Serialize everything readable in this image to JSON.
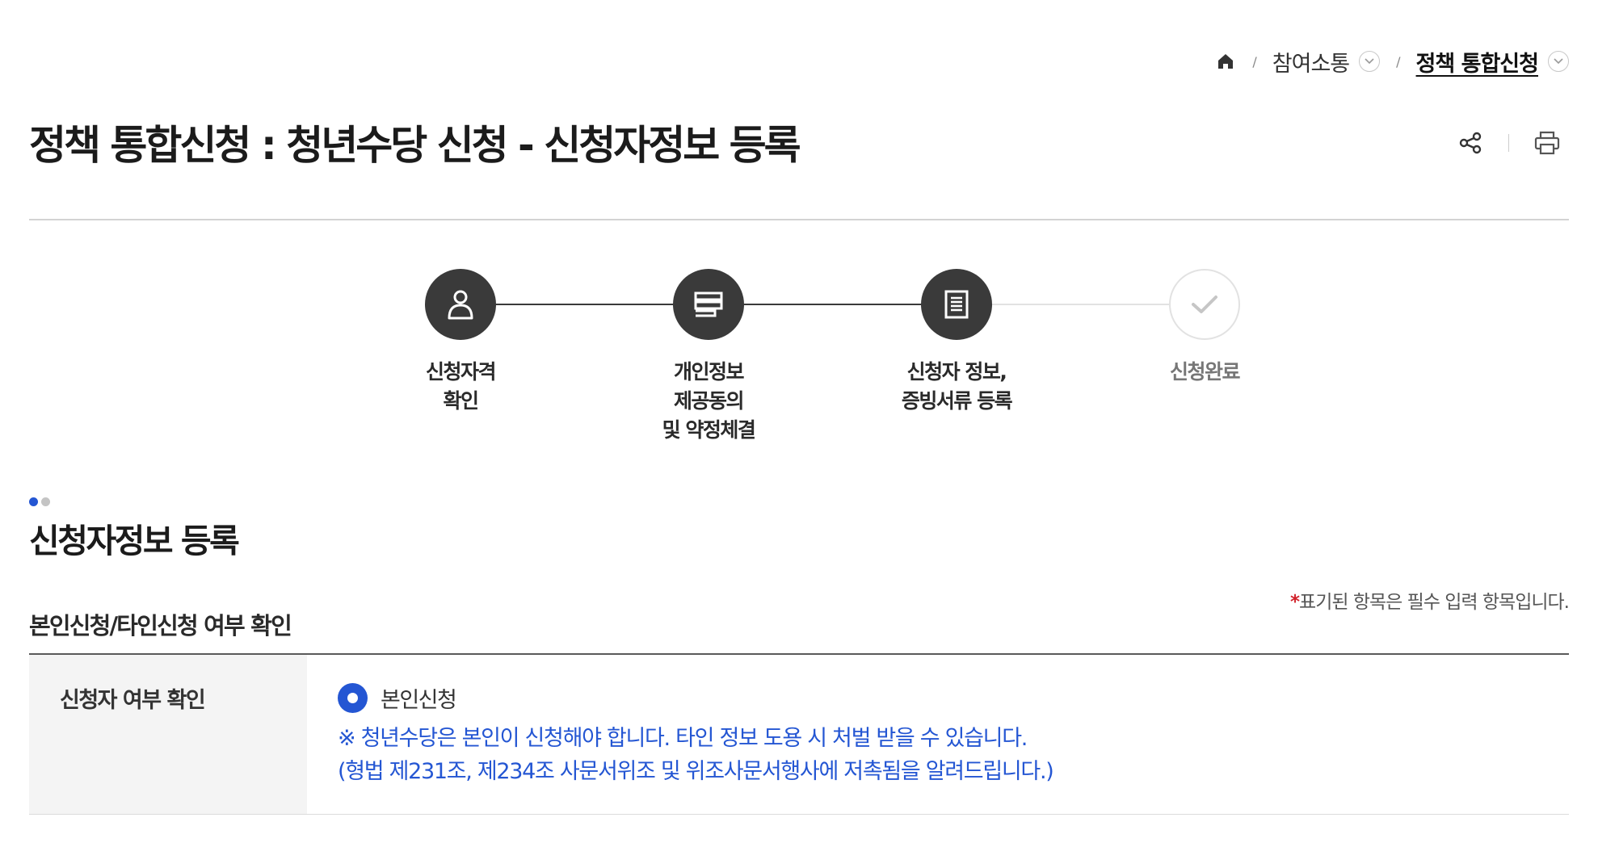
{
  "breadcrumb": {
    "home_icon": "home-icon",
    "items": [
      {
        "label": "참여소통"
      },
      {
        "label": "정책 통합신청"
      }
    ]
  },
  "page": {
    "title": "정책 통합신청 : 청년수당 신청 - 신청자정보 등록",
    "tools": [
      "share-icon",
      "print-icon"
    ]
  },
  "steps": [
    {
      "label": "신청자격\n확인",
      "state": "done",
      "icon": "person-icon"
    },
    {
      "label": "개인정보\n제공동의\n및 약정체결",
      "state": "done",
      "icon": "consent-icon"
    },
    {
      "label": "신청자 정보,\n증빙서류 등록",
      "state": "done",
      "icon": "document-icon"
    },
    {
      "label": "신청완료",
      "state": "todo",
      "icon": "check-icon"
    }
  ],
  "section": {
    "title": "신청자정보 등록",
    "required_mark": "*",
    "required_note": "표기된 항목은 필수 입력 항목입니다.",
    "subtitle": "본인신청/타인신청 여부 확인"
  },
  "form": {
    "row_label": "신청자 여부 확인",
    "radio_label": "본인신청",
    "radio_checked": true,
    "notice_line1": "※ 청년수당은 본인이 신청해야 합니다. 타인 정보 도용 시 처벌 받을 수 있습니다.",
    "notice_line2": "(형법 제231조, 제234조 사문서위조 및 위조사문서행사에 저촉됨을 알려드립니다.)"
  },
  "colors": {
    "accent": "#2456d3",
    "step_done": "#3a3a3a",
    "required": "#d1222b",
    "dot_active": "#2456d3",
    "dot_inactive": "#c4c4c4"
  }
}
